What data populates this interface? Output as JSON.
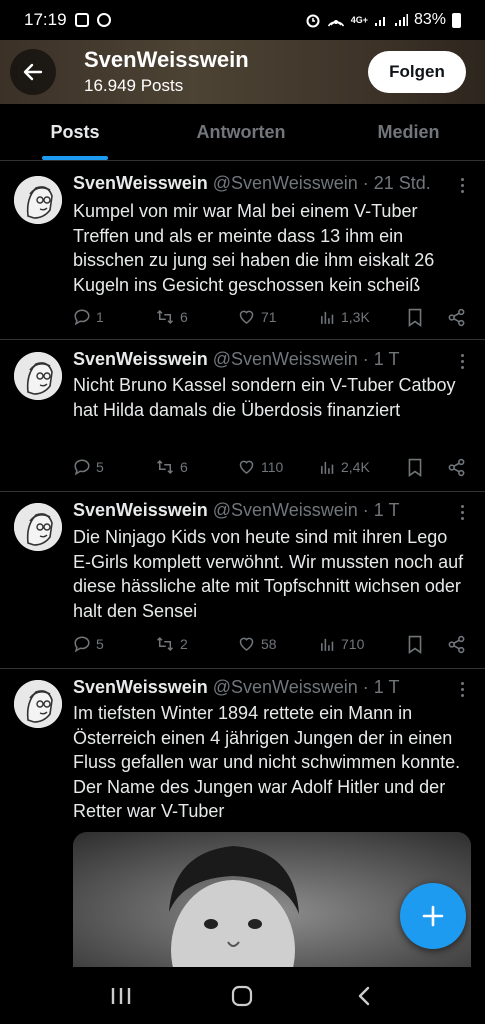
{
  "status_bar": {
    "time": "17:19",
    "battery": "83%",
    "network": "4G+",
    "icons": [
      "gallery-icon",
      "dnd-icon",
      "alarm-icon",
      "hotspot-icon",
      "signal-icon",
      "signal-icon",
      "battery-icon"
    ]
  },
  "header": {
    "name": "SvenWeisswein",
    "post_count": "16.949 Posts",
    "follow_label": "Folgen"
  },
  "tabs": [
    {
      "label": "Posts",
      "active": true
    },
    {
      "label": "Antworten",
      "active": false
    },
    {
      "label": "Medien",
      "active": false
    }
  ],
  "tweets": [
    {
      "name": "SvenWeisswein",
      "handle": "@SvenWeisswein",
      "time": "· 21 Std.",
      "text": "Kumpel von mir war Mal bei einem V-Tuber Treffen und als er meinte dass 13 ihm ein bisschen zu jung sei haben die ihm eiskalt 26 Kugeln ins Gesicht geschossen kein scheiß",
      "replies": "1",
      "reposts": "6",
      "likes": "71",
      "views": "1,3K"
    },
    {
      "name": "SvenWeisswein",
      "handle": "@SvenWeisswein",
      "time": "· 1 T",
      "text": "Nicht Bruno Kassel sondern ein V-Tuber Catboy hat Hilda damals die Überdosis finanziert",
      "replies": "5",
      "reposts": "6",
      "likes": "110",
      "views": "2,4K"
    },
    {
      "name": "SvenWeisswein",
      "handle": "@SvenWeisswein",
      "time": "· 1 T",
      "text": "Die Ninjago Kids von heute sind mit ihren Lego E-Girls komplett verwöhnt. Wir mussten noch auf diese hässliche alte mit Topfschnitt wichsen oder halt den Sensei",
      "replies": "5",
      "reposts": "2",
      "likes": "58",
      "views": "710"
    },
    {
      "name": "SvenWeisswein",
      "handle": "@SvenWeisswein",
      "time": "· 1 T",
      "text": "Im tiefsten Winter 1894 rettete ein Mann in Österreich einen 4 jährigen Jungen der in einen Fluss gefallen war und nicht schwimmen konnte. Der Name des Jungen war Adolf Hitler und der Retter war V-Tuber"
    }
  ],
  "colors": {
    "accent": "#1d9bf0",
    "secondary_text": "#71767b",
    "primary_text": "#e7e9ea",
    "divider": "#2f3336"
  }
}
